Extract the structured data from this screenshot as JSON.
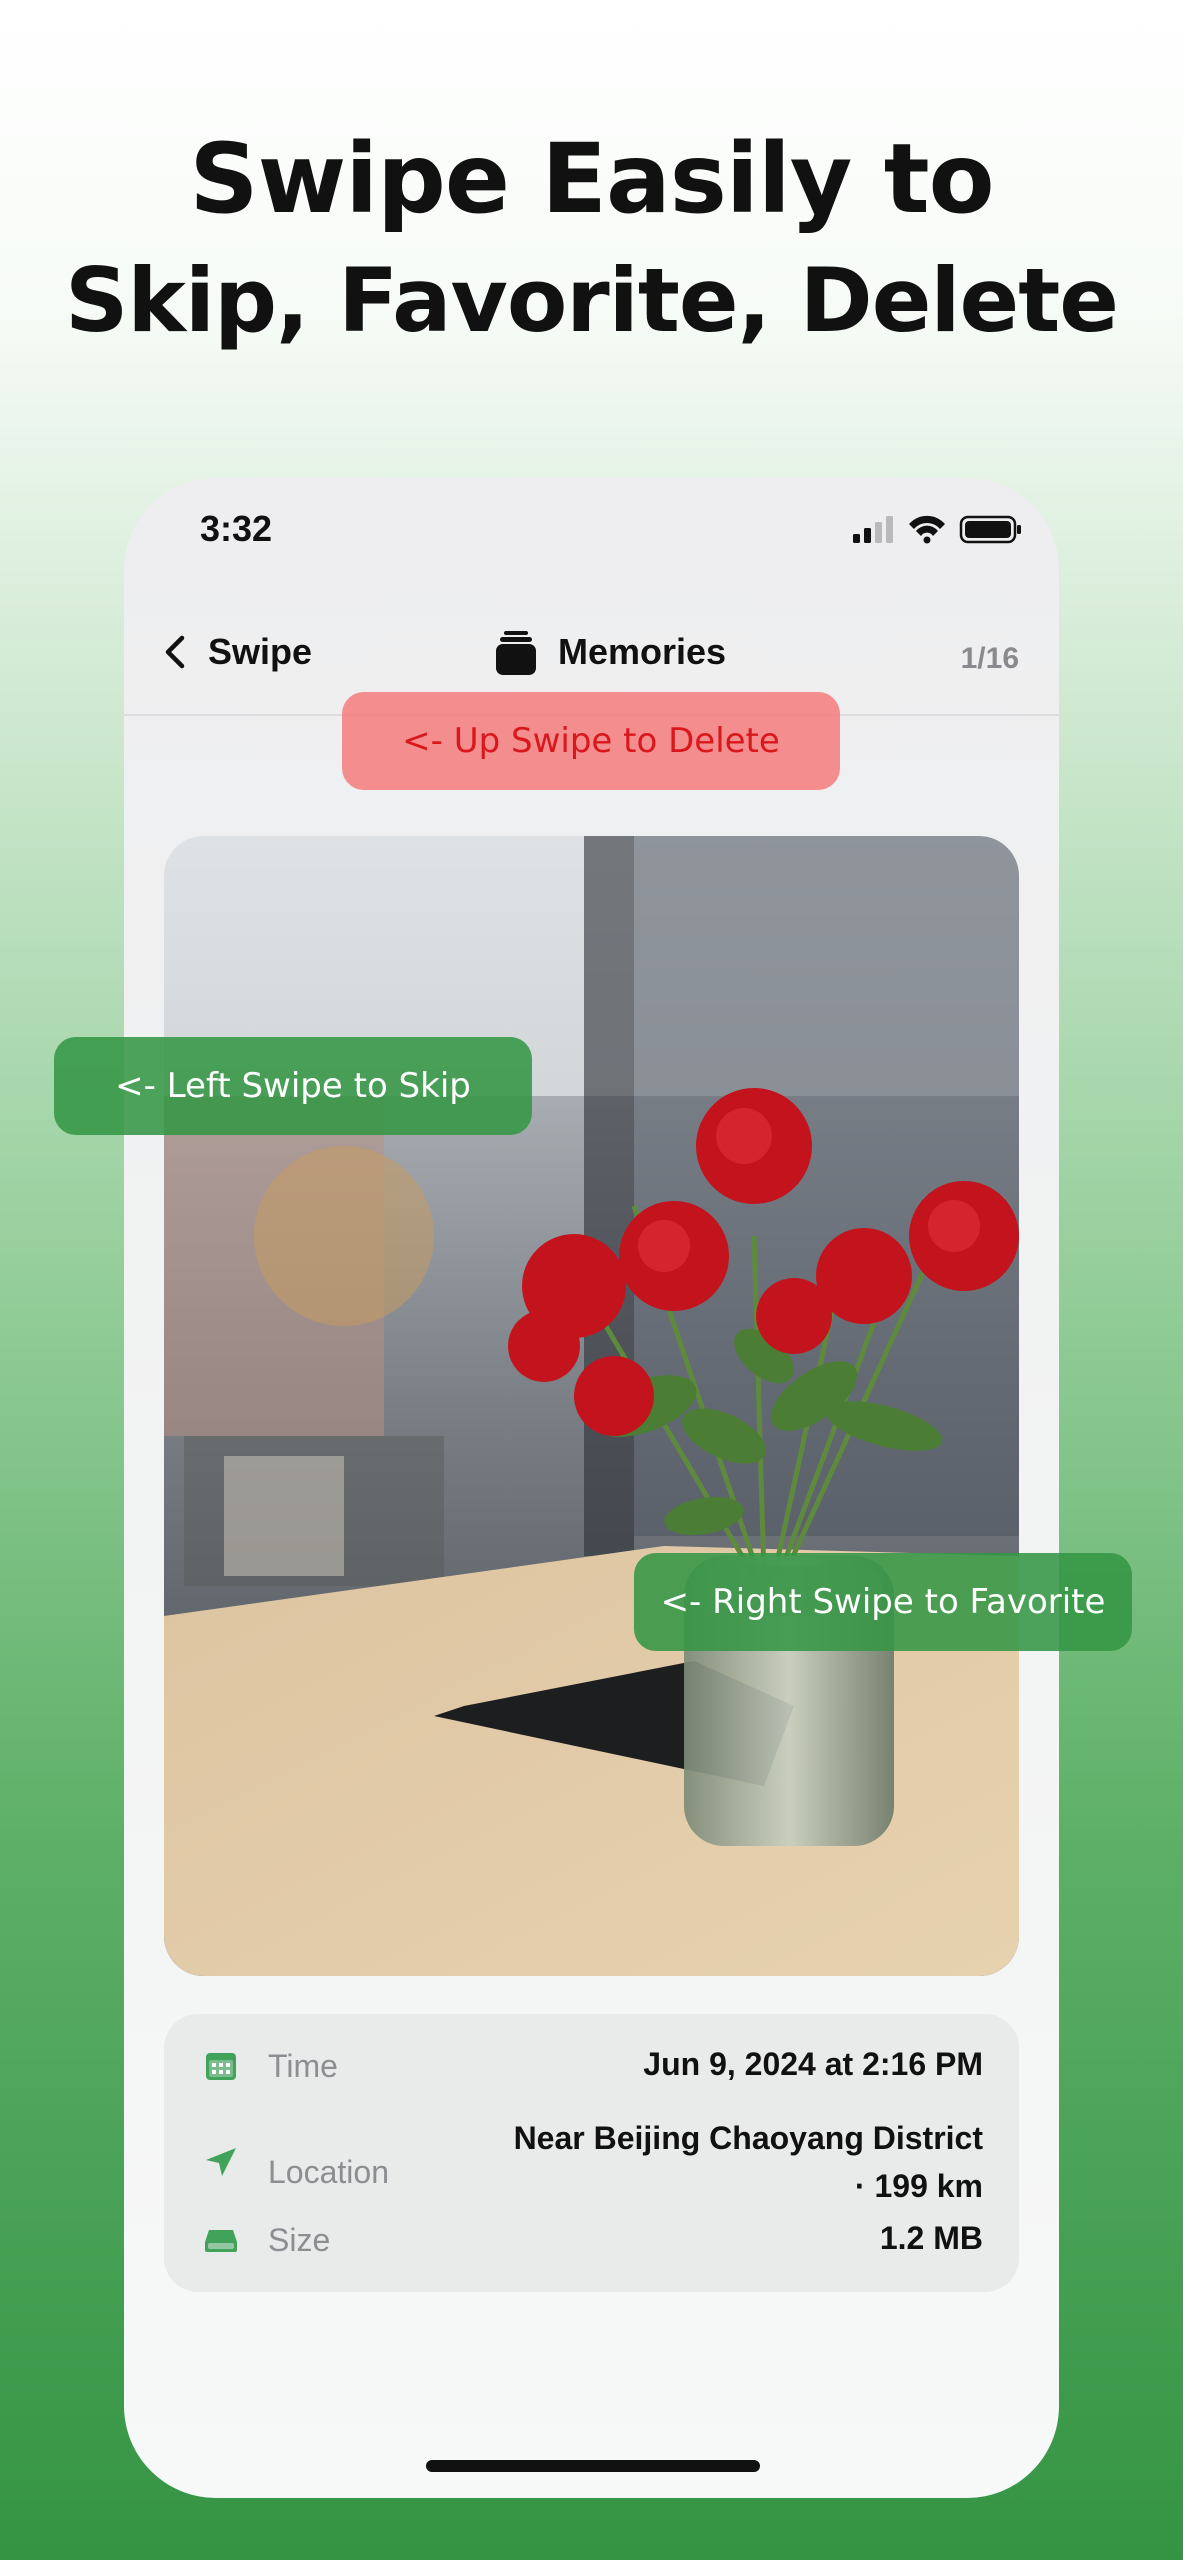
{
  "headline": {
    "line1": "Swipe Easily to",
    "line2": "Skip, Favorite, Delete"
  },
  "status_bar": {
    "time": "3:32",
    "icons": [
      "cellular-signal-icon",
      "wifi-icon",
      "battery-icon"
    ]
  },
  "navbar": {
    "back_label": "Swipe",
    "title": "Memories",
    "counter": "1/16",
    "icons": [
      "chevron-left-icon",
      "stack-icon"
    ]
  },
  "photo": {
    "subject": "red-roses-in-glass-vase"
  },
  "info": {
    "rows": [
      {
        "icon": "calendar-icon",
        "label": "Time",
        "value": "Jun 9, 2024 at 2:16 PM"
      },
      {
        "icon": "location-arrow-icon",
        "label": "Location",
        "value_line1": "Near Beijing Chaoyang District",
        "value_line2": "· 199 km"
      },
      {
        "icon": "storage-icon",
        "label": "Size",
        "value": "1.2 MB"
      }
    ]
  },
  "hints": {
    "delete": "<- Up Swipe to Delete",
    "skip": "<- Left Swipe to Skip",
    "favorite": "<- Right Swipe to Favorite"
  },
  "colors": {
    "accent_green": "#349443",
    "delete_red": "#d8181c",
    "delete_bg": "#f57878"
  }
}
